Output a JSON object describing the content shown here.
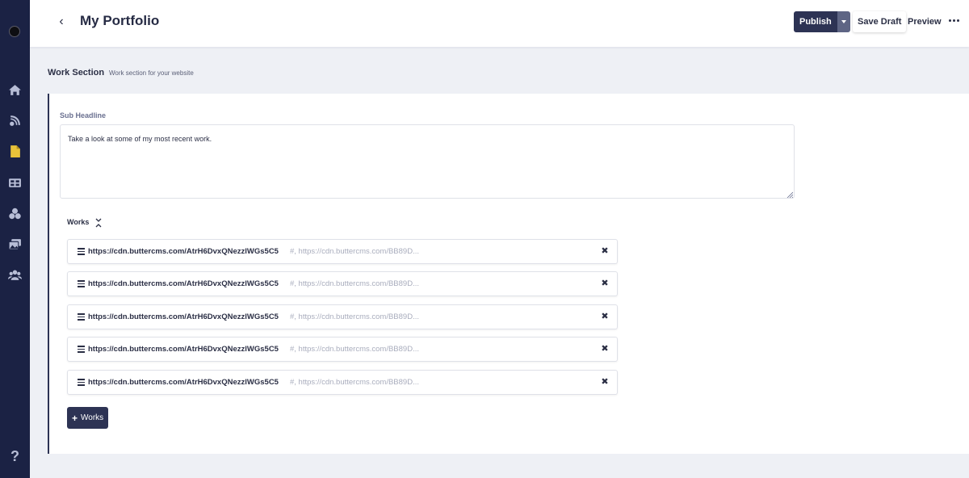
{
  "header": {
    "title": "My Portfolio",
    "back_label": "‹",
    "publish_label": "Publish",
    "save_draft_label": "Save Draft",
    "preview_label": "Preview"
  },
  "section": {
    "title": "Work Section",
    "subtitle": "Work section for your website"
  },
  "sub_headline": {
    "label": "Sub Headline",
    "value": "Take a look at some of my most recent work."
  },
  "works": {
    "label": "Works",
    "add_label": "Works",
    "items": [
      {
        "url": "https://cdn.buttercms.com/AtrH6DvxQNezzlWGs5C5",
        "meta": "#, https://cdn.buttercms.com/BB89D..."
      },
      {
        "url": "https://cdn.buttercms.com/AtrH6DvxQNezzlWGs5C5",
        "meta": "#, https://cdn.buttercms.com/BB89D..."
      },
      {
        "url": "https://cdn.buttercms.com/AtrH6DvxQNezzlWGs5C5",
        "meta": "#, https://cdn.buttercms.com/BB89D..."
      },
      {
        "url": "https://cdn.buttercms.com/AtrH6DvxQNezzlWGs5C5",
        "meta": "#, https://cdn.buttercms.com/BB89D..."
      },
      {
        "url": "https://cdn.buttercms.com/AtrH6DvxQNezzlWGs5C5",
        "meta": "#, https://cdn.buttercms.com/BB89D..."
      }
    ]
  },
  "sidebar": {
    "icons": [
      "home-icon",
      "blog-icon",
      "pages-icon",
      "collections-icon",
      "components-icon",
      "media-icon",
      "users-icon"
    ],
    "help_label": "?"
  },
  "colors": {
    "sidebar_bg": "#1b2244",
    "accent": "#2d3354",
    "active_icon": "#e8c23a"
  }
}
